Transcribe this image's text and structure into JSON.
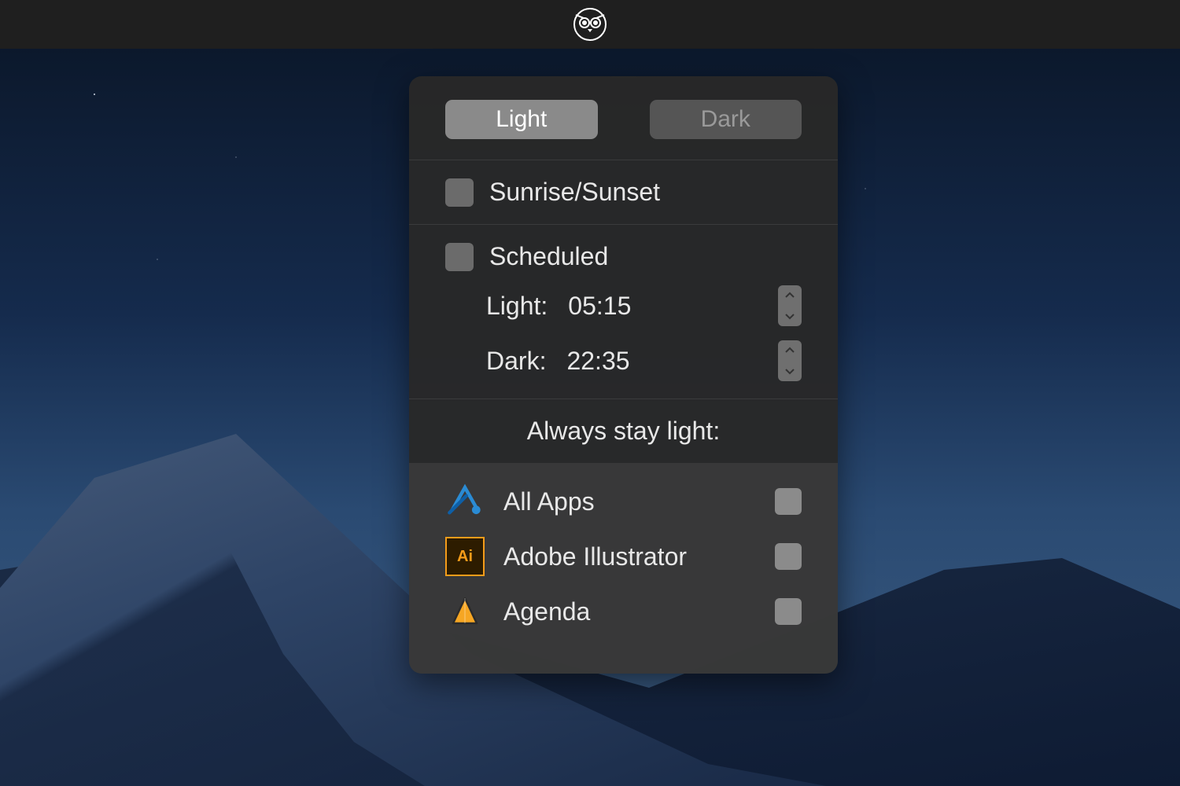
{
  "menubar": {
    "app_icon": "owl-icon"
  },
  "popover": {
    "mode_toggle": {
      "light": "Light",
      "dark": "Dark",
      "active": "light"
    },
    "sunrise_sunset": {
      "label": "Sunrise/Sunset",
      "checked": false
    },
    "scheduled": {
      "label": "Scheduled",
      "checked": false,
      "light_label": "Light:",
      "light_time": "05:15",
      "dark_label": "Dark:",
      "dark_time": "22:35"
    },
    "always_stay_light_label": "Always stay light:",
    "apps": [
      {
        "name": "All Apps",
        "icon": "all-apps",
        "checked": false
      },
      {
        "name": "Adobe Illustrator",
        "icon": "ai",
        "checked": false
      },
      {
        "name": "Agenda",
        "icon": "agenda",
        "checked": false
      }
    ]
  }
}
